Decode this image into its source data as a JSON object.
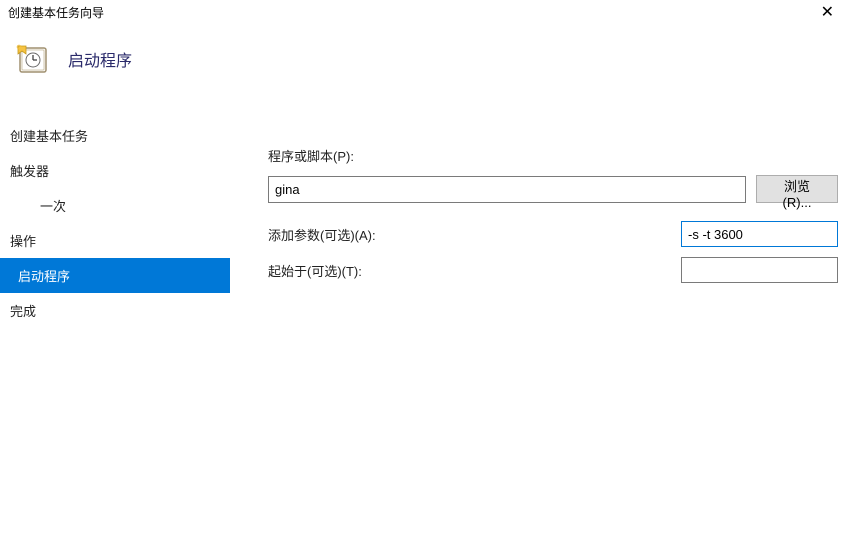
{
  "titlebar": {
    "title": "创建基本任务向导"
  },
  "header": {
    "title": "启动程序"
  },
  "sidebar": {
    "items": [
      {
        "label": "创建基本任务",
        "indent": false,
        "selected": false
      },
      {
        "label": "触发器",
        "indent": false,
        "selected": false
      },
      {
        "label": "一次",
        "indent": true,
        "selected": false
      },
      {
        "label": "操作",
        "indent": false,
        "selected": false
      },
      {
        "label": "启动程序",
        "indent": false,
        "selected": true
      },
      {
        "label": "完成",
        "indent": false,
        "selected": false
      }
    ]
  },
  "form": {
    "program_label": "程序或脚本(P):",
    "program_value": "gina",
    "browse_label": "浏览(R)...",
    "args_label": "添加参数(可选)(A):",
    "args_value": "-s -t 3600",
    "startin_label": "起始于(可选)(T):",
    "startin_value": ""
  }
}
